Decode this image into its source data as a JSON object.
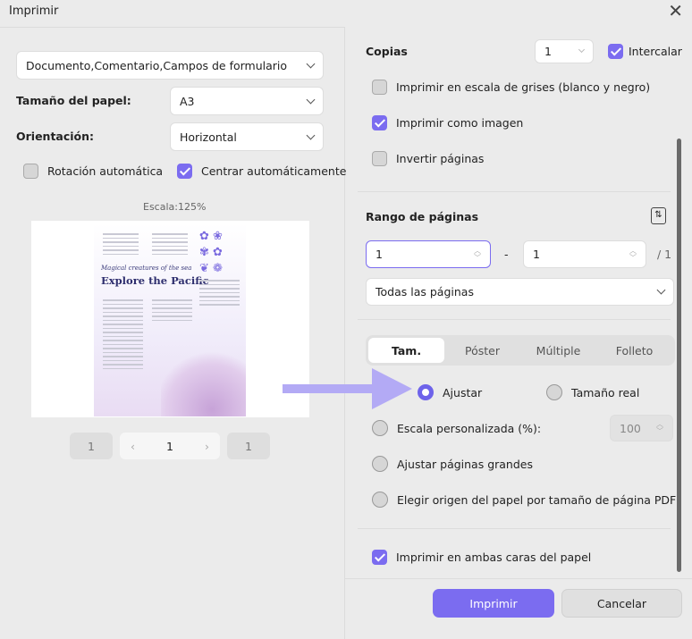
{
  "window": {
    "title": "Imprimir"
  },
  "left": {
    "content_select": "Documento,Comentario,Campos de formulario",
    "paper_size_label": "Tamaño del papel:",
    "paper_size": "A3",
    "orientation_label": "Orientación:",
    "orientation": "Horizontal",
    "auto_rotate": {
      "label": "Rotación automática",
      "checked": false
    },
    "auto_center": {
      "label": "Centrar automáticamente",
      "checked": true
    },
    "scale_label": "Escala:125%",
    "preview": {
      "subtitle": "Magical creatures of the sea",
      "title": "Explore the Pacific"
    },
    "pager": {
      "first": "1",
      "current": "1",
      "last": "1"
    }
  },
  "right": {
    "copies_label": "Copias",
    "copies": "1",
    "collate": {
      "label": "Intercalar",
      "checked": true
    },
    "grayscale": {
      "label": "Imprimir en escala de grises (blanco y negro)",
      "checked": false
    },
    "as_image": {
      "label": "Imprimir como imagen",
      "checked": true
    },
    "reverse": {
      "label": "Invertir páginas",
      "checked": false
    },
    "range_label": "Rango de páginas",
    "range_from": "1",
    "range_dash": "-",
    "range_to": "1",
    "range_total": "/ 1",
    "range_select": "Todas las páginas",
    "tabs": [
      {
        "label": "Tam."
      },
      {
        "label": "Póster"
      },
      {
        "label": "Múltiple"
      },
      {
        "label": "Folleto"
      }
    ],
    "fit": {
      "label": "Ajustar",
      "selected": true
    },
    "actual": {
      "label": "Tamaño real",
      "selected": false
    },
    "custom": {
      "label": "Escala personalizada (%):",
      "value": "100"
    },
    "shrink": {
      "label": "Ajustar páginas grandes"
    },
    "paper_source": {
      "label": "Elegir origen del papel por tamaño de página PDF"
    },
    "duplex": {
      "label": "Imprimir en ambas caras del papel",
      "checked": true
    }
  },
  "footer": {
    "print": "Imprimir",
    "cancel": "Cancelar"
  },
  "colors": {
    "accent": "#7b6cf0",
    "arrow": "#b3aaf5"
  }
}
